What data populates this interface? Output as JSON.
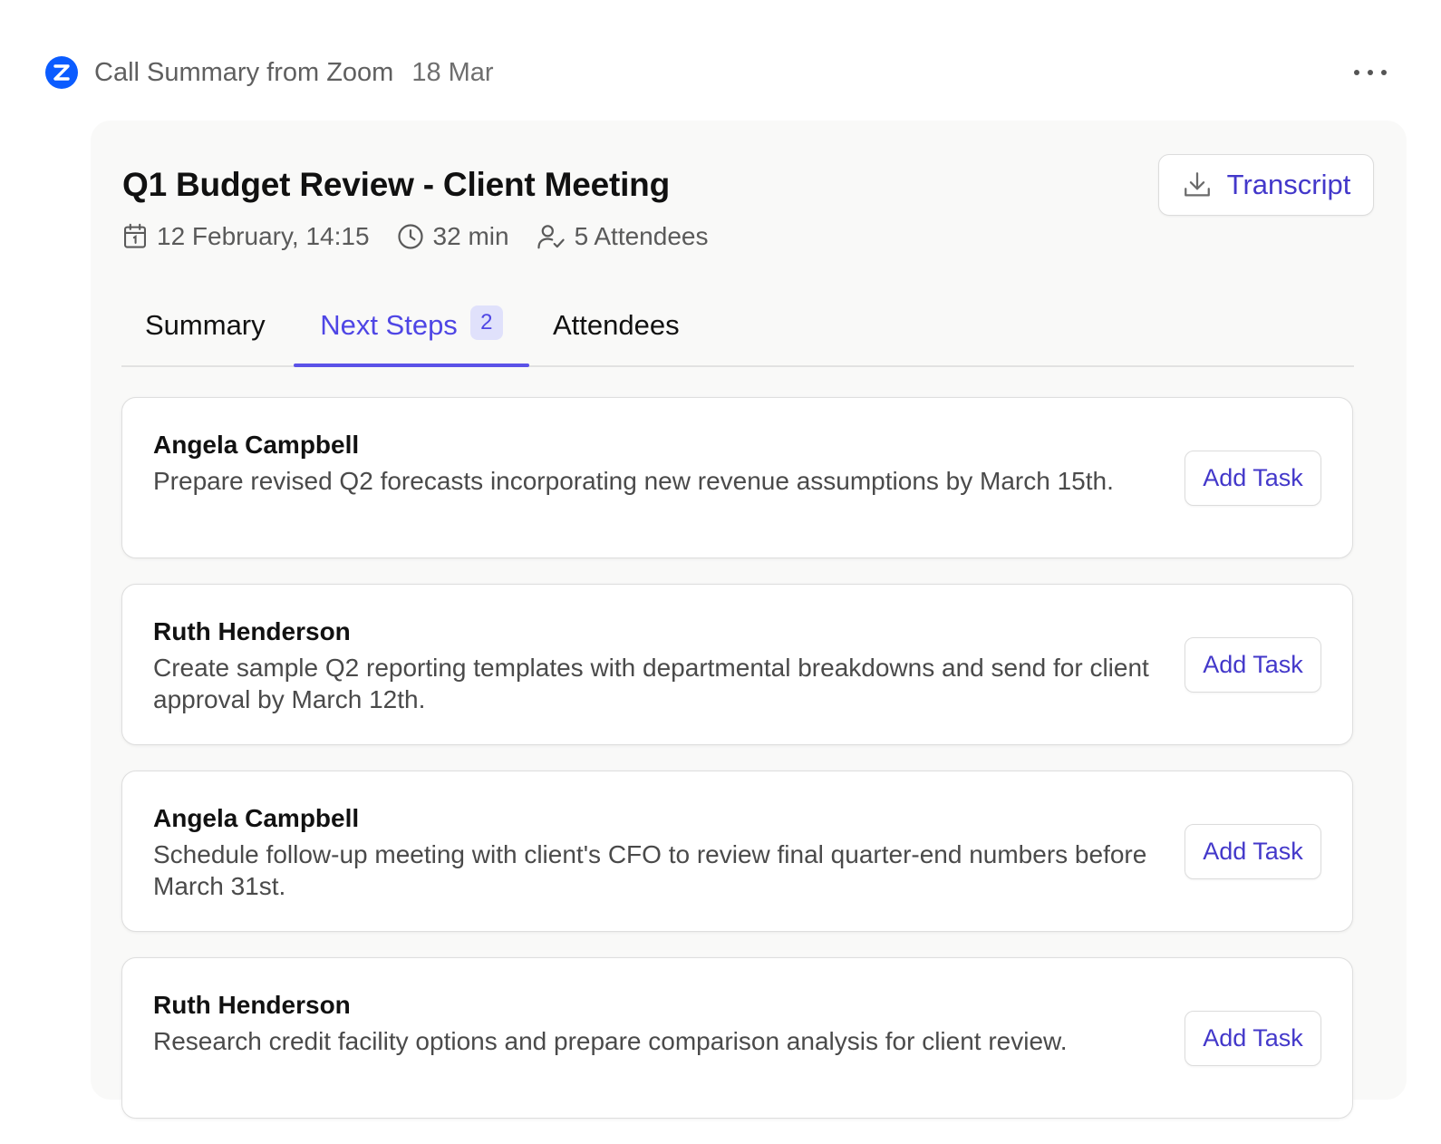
{
  "header": {
    "logo_icon": "zoom-logo-icon",
    "brand_color": "#0b5cff",
    "source": "Call Summary from Zoom",
    "date": "18 Mar",
    "more_icon": "more-horizontal-icon"
  },
  "meeting": {
    "title": "Q1 Budget Review - Client Meeting",
    "transcript_label": "Transcript",
    "transcript_icon": "download-icon",
    "datetime": "12 February, 14:15",
    "datetime_icon": "calendar-icon",
    "duration": "32 min",
    "duration_icon": "clock-icon",
    "attendees": "5 Attendees",
    "attendees_icon": "user-check-icon"
  },
  "tabs": [
    {
      "label": "Summary",
      "active": false
    },
    {
      "label": "Next Steps",
      "badge": "2",
      "active": true
    },
    {
      "label": "Attendees",
      "active": false
    }
  ],
  "accent_color": "#4f46e5",
  "steps": [
    {
      "name": "Angela Campbell",
      "text": "Prepare revised Q2 forecasts incorporating new revenue assumptions by March 15th.",
      "action": "Add Task"
    },
    {
      "name": "Ruth Henderson",
      "text": "Create sample Q2 reporting templates with departmental breakdowns and send for client approval by March 12th.",
      "action": "Add Task"
    },
    {
      "name": "Angela Campbell",
      "text": "Schedule follow-up meeting with client's CFO to review final quarter-end numbers before March 31st.",
      "action": "Add Task"
    },
    {
      "name": "Ruth Henderson",
      "text": "Research credit facility options and prepare comparison analysis for client review.",
      "action": "Add Task"
    }
  ]
}
